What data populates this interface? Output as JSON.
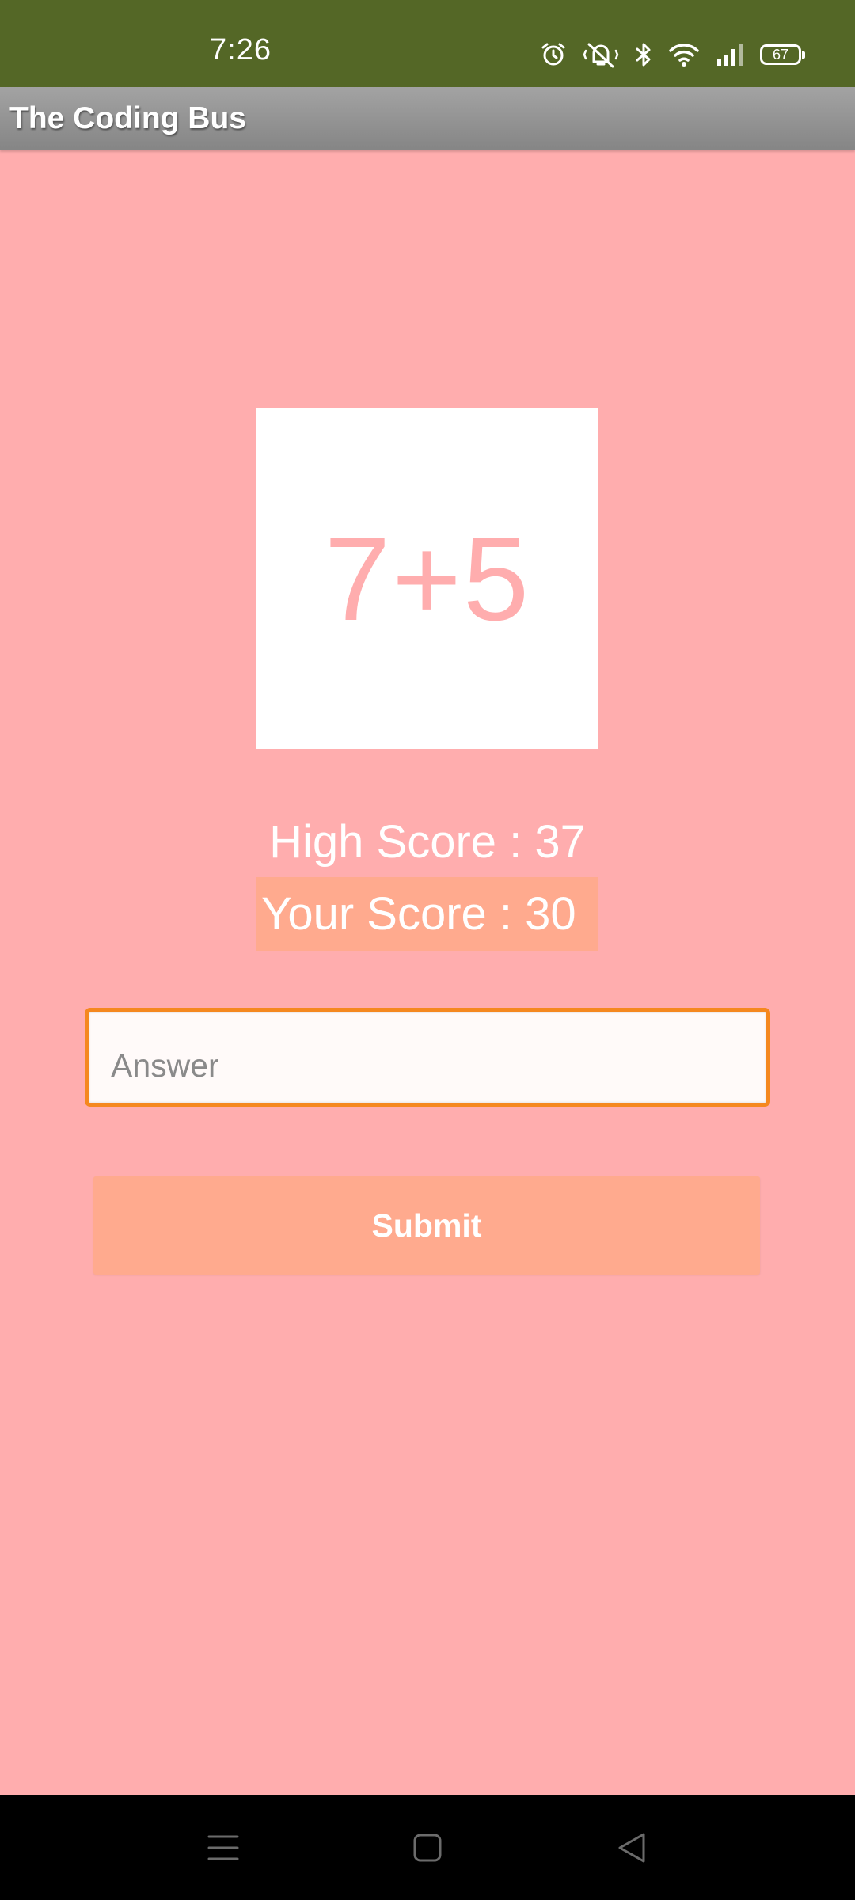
{
  "status_bar": {
    "time": "7:26",
    "battery": "67",
    "icons": [
      "alarm-icon",
      "vibrate-icon",
      "bluetooth-icon",
      "wifi-icon",
      "signal-icon",
      "battery-icon"
    ]
  },
  "app_bar": {
    "title": "The Coding Bus"
  },
  "game": {
    "question": "7+5",
    "high_score": "High Score : 37",
    "your_score": "Your Score : 30",
    "answer_placeholder": "Answer",
    "answer_value": "",
    "submit_label": "Submit"
  },
  "nav_bar": {
    "buttons": [
      "menu-icon",
      "home-icon",
      "back-icon"
    ]
  },
  "colors": {
    "status_bar": "#546726",
    "background": "#ffadae",
    "accent": "#ffaa8e",
    "input_border": "#f5881f"
  }
}
